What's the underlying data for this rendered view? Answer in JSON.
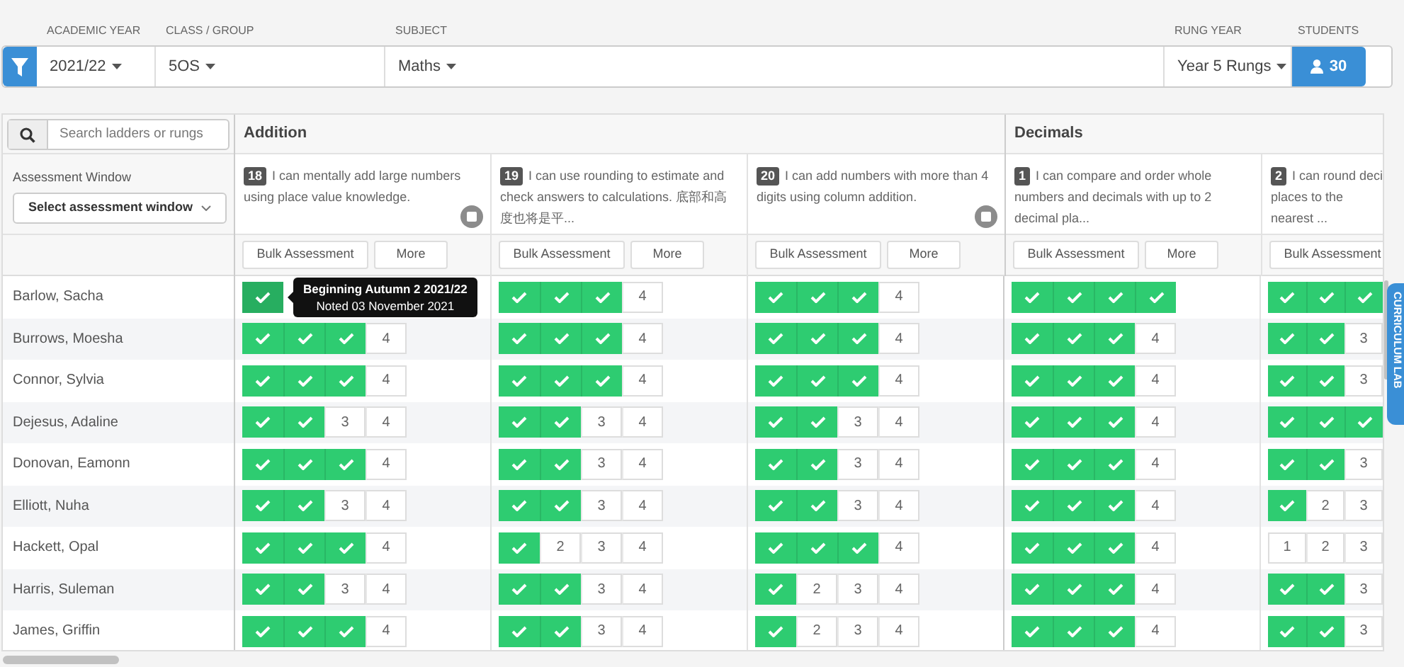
{
  "filters": [
    {
      "label": "ACADEMIC YEAR",
      "value": "2021/22"
    },
    {
      "label": "CLASS / GROUP",
      "value": "5OS"
    },
    {
      "label": "SUBJECT",
      "value": "Maths"
    },
    {
      "label": "RUNG YEAR",
      "value": "Year 5 Rungs"
    }
  ],
  "students_count": {
    "label": "STUDENTS",
    "value": "30"
  },
  "search": {
    "placeholder": "Search ladders or rungs"
  },
  "assessment_window": {
    "label": "Assessment Window",
    "value": "Select assessment window"
  },
  "groups": [
    {
      "title": "Addition",
      "rungs": [
        {
          "number": "18",
          "text": "I can mentally add large numbers using place value knowledge.",
          "note": true,
          "buttons": [
            "Bulk Assessment",
            "More"
          ]
        },
        {
          "number": "19",
          "text": "I can use rounding to estimate and check answers to calculations. 底部和高度也将是平...",
          "note": false,
          "buttons": [
            "Bulk Assessment",
            "More"
          ]
        },
        {
          "number": "20",
          "text": "I can add numbers with more than 4 digits using column addition.",
          "note": true,
          "buttons": [
            "Bulk Assessment",
            "More"
          ]
        }
      ]
    },
    {
      "title": "Decimals",
      "rungs": [
        {
          "number": "1",
          "text": "I can compare and order whole numbers and decimals with up to 2 decimal pla...",
          "note": false,
          "buttons": [
            "Bulk Assessment",
            "More"
          ]
        },
        {
          "number": "2",
          "text": "I can round deci places to the nearest ...",
          "note": false,
          "buttons": [
            "Bulk Assessment"
          ]
        }
      ]
    }
  ],
  "students": [
    {
      "name": "Barlow, Sacha",
      "cells": [
        {
          "steps": [
            {
              "done": true
            }
          ],
          "tooltip": {
            "title": "Beginning Autumn 2 2021/22",
            "note": "Noted 03 November 2021"
          }
        },
        {
          "steps": [
            {
              "done": true
            },
            {
              "done": true
            },
            {
              "done": true
            },
            {
              "done": false,
              "label": "4"
            }
          ]
        },
        {
          "steps": [
            {
              "done": true
            },
            {
              "done": true
            },
            {
              "done": true
            },
            {
              "done": false,
              "label": "4"
            }
          ]
        },
        {
          "steps": [
            {
              "done": true
            },
            {
              "done": true
            },
            {
              "done": true
            },
            {
              "done": true
            }
          ]
        },
        {
          "steps": [
            {
              "done": true
            },
            {
              "done": true
            },
            {
              "done": true
            }
          ]
        }
      ]
    },
    {
      "name": "Burrows, Moesha",
      "cells": [
        {
          "steps": [
            {
              "done": true
            },
            {
              "done": true
            },
            {
              "done": true
            },
            {
              "done": false,
              "label": "4"
            }
          ]
        },
        {
          "steps": [
            {
              "done": true
            },
            {
              "done": true
            },
            {
              "done": true
            },
            {
              "done": false,
              "label": "4"
            }
          ]
        },
        {
          "steps": [
            {
              "done": true
            },
            {
              "done": true
            },
            {
              "done": true
            },
            {
              "done": false,
              "label": "4"
            }
          ]
        },
        {
          "steps": [
            {
              "done": true
            },
            {
              "done": true
            },
            {
              "done": true
            },
            {
              "done": false,
              "label": "4"
            }
          ]
        },
        {
          "steps": [
            {
              "done": true
            },
            {
              "done": true
            },
            {
              "done": false,
              "label": "3"
            }
          ]
        }
      ]
    },
    {
      "name": "Connor, Sylvia",
      "cells": [
        {
          "steps": [
            {
              "done": true
            },
            {
              "done": true
            },
            {
              "done": true
            },
            {
              "done": false,
              "label": "4"
            }
          ]
        },
        {
          "steps": [
            {
              "done": true
            },
            {
              "done": true
            },
            {
              "done": true
            },
            {
              "done": false,
              "label": "4"
            }
          ]
        },
        {
          "steps": [
            {
              "done": true
            },
            {
              "done": true
            },
            {
              "done": true
            },
            {
              "done": false,
              "label": "4"
            }
          ]
        },
        {
          "steps": [
            {
              "done": true
            },
            {
              "done": true
            },
            {
              "done": true
            },
            {
              "done": false,
              "label": "4"
            }
          ]
        },
        {
          "steps": [
            {
              "done": true
            },
            {
              "done": true
            },
            {
              "done": false,
              "label": "3"
            }
          ]
        }
      ]
    },
    {
      "name": "Dejesus, Adaline",
      "cells": [
        {
          "steps": [
            {
              "done": true
            },
            {
              "done": true
            },
            {
              "done": false,
              "label": "3"
            },
            {
              "done": false,
              "label": "4"
            }
          ]
        },
        {
          "steps": [
            {
              "done": true
            },
            {
              "done": true
            },
            {
              "done": false,
              "label": "3"
            },
            {
              "done": false,
              "label": "4"
            }
          ]
        },
        {
          "steps": [
            {
              "done": true
            },
            {
              "done": true
            },
            {
              "done": false,
              "label": "3"
            },
            {
              "done": false,
              "label": "4"
            }
          ]
        },
        {
          "steps": [
            {
              "done": true
            },
            {
              "done": true
            },
            {
              "done": true
            },
            {
              "done": false,
              "label": "4"
            }
          ]
        },
        {
          "steps": [
            {
              "done": true
            },
            {
              "done": true
            },
            {
              "done": true
            }
          ]
        }
      ]
    },
    {
      "name": "Donovan, Eamonn",
      "cells": [
        {
          "steps": [
            {
              "done": true
            },
            {
              "done": true
            },
            {
              "done": true
            },
            {
              "done": false,
              "label": "4"
            }
          ]
        },
        {
          "steps": [
            {
              "done": true
            },
            {
              "done": true
            },
            {
              "done": false,
              "label": "3"
            },
            {
              "done": false,
              "label": "4"
            }
          ]
        },
        {
          "steps": [
            {
              "done": true
            },
            {
              "done": true
            },
            {
              "done": false,
              "label": "3"
            },
            {
              "done": false,
              "label": "4"
            }
          ]
        },
        {
          "steps": [
            {
              "done": true
            },
            {
              "done": true
            },
            {
              "done": true
            },
            {
              "done": false,
              "label": "4"
            }
          ]
        },
        {
          "steps": [
            {
              "done": true
            },
            {
              "done": true
            },
            {
              "done": false,
              "label": "3"
            }
          ]
        }
      ]
    },
    {
      "name": "Elliott, Nuha",
      "cells": [
        {
          "steps": [
            {
              "done": true
            },
            {
              "done": true
            },
            {
              "done": false,
              "label": "3"
            },
            {
              "done": false,
              "label": "4"
            }
          ]
        },
        {
          "steps": [
            {
              "done": true
            },
            {
              "done": true
            },
            {
              "done": false,
              "label": "3"
            },
            {
              "done": false,
              "label": "4"
            }
          ]
        },
        {
          "steps": [
            {
              "done": true
            },
            {
              "done": true
            },
            {
              "done": false,
              "label": "3"
            },
            {
              "done": false,
              "label": "4"
            }
          ]
        },
        {
          "steps": [
            {
              "done": true
            },
            {
              "done": true
            },
            {
              "done": true
            },
            {
              "done": false,
              "label": "4"
            }
          ]
        },
        {
          "steps": [
            {
              "done": true
            },
            {
              "done": false,
              "label": "2"
            },
            {
              "done": false,
              "label": "3"
            }
          ]
        }
      ]
    },
    {
      "name": "Hackett, Opal",
      "cells": [
        {
          "steps": [
            {
              "done": true
            },
            {
              "done": true
            },
            {
              "done": true
            },
            {
              "done": false,
              "label": "4"
            }
          ]
        },
        {
          "steps": [
            {
              "done": true
            },
            {
              "done": false,
              "label": "2"
            },
            {
              "done": false,
              "label": "3"
            },
            {
              "done": false,
              "label": "4"
            }
          ]
        },
        {
          "steps": [
            {
              "done": true
            },
            {
              "done": true
            },
            {
              "done": true
            },
            {
              "done": false,
              "label": "4"
            }
          ]
        },
        {
          "steps": [
            {
              "done": true
            },
            {
              "done": true
            },
            {
              "done": true
            },
            {
              "done": false,
              "label": "4"
            }
          ]
        },
        {
          "steps": [
            {
              "done": false,
              "label": "1"
            },
            {
              "done": false,
              "label": "2"
            },
            {
              "done": false,
              "label": "3"
            }
          ]
        }
      ]
    },
    {
      "name": "Harris, Suleman",
      "cells": [
        {
          "steps": [
            {
              "done": true
            },
            {
              "done": true
            },
            {
              "done": false,
              "label": "3"
            },
            {
              "done": false,
              "label": "4"
            }
          ]
        },
        {
          "steps": [
            {
              "done": true
            },
            {
              "done": true
            },
            {
              "done": false,
              "label": "3"
            },
            {
              "done": false,
              "label": "4"
            }
          ]
        },
        {
          "steps": [
            {
              "done": true
            },
            {
              "done": false,
              "label": "2"
            },
            {
              "done": false,
              "label": "3"
            },
            {
              "done": false,
              "label": "4"
            }
          ]
        },
        {
          "steps": [
            {
              "done": true
            },
            {
              "done": true
            },
            {
              "done": true
            },
            {
              "done": false,
              "label": "4"
            }
          ]
        },
        {
          "steps": [
            {
              "done": true
            },
            {
              "done": true
            },
            {
              "done": false,
              "label": "3"
            }
          ]
        }
      ]
    },
    {
      "name": "James, Griffin",
      "cells": [
        {
          "steps": [
            {
              "done": true
            },
            {
              "done": true
            },
            {
              "done": true
            },
            {
              "done": false,
              "label": "4"
            }
          ]
        },
        {
          "steps": [
            {
              "done": true
            },
            {
              "done": true
            },
            {
              "done": false,
              "label": "3"
            },
            {
              "done": false,
              "label": "4"
            }
          ]
        },
        {
          "steps": [
            {
              "done": true
            },
            {
              "done": false,
              "label": "2"
            },
            {
              "done": false,
              "label": "3"
            },
            {
              "done": false,
              "label": "4"
            }
          ]
        },
        {
          "steps": [
            {
              "done": true
            },
            {
              "done": true
            },
            {
              "done": true
            },
            {
              "done": false,
              "label": "4"
            }
          ]
        },
        {
          "steps": [
            {
              "done": true
            },
            {
              "done": true
            },
            {
              "done": false,
              "label": "3"
            }
          ]
        }
      ]
    }
  ],
  "side_tab": {
    "label": "CURRICULUM LAB"
  }
}
